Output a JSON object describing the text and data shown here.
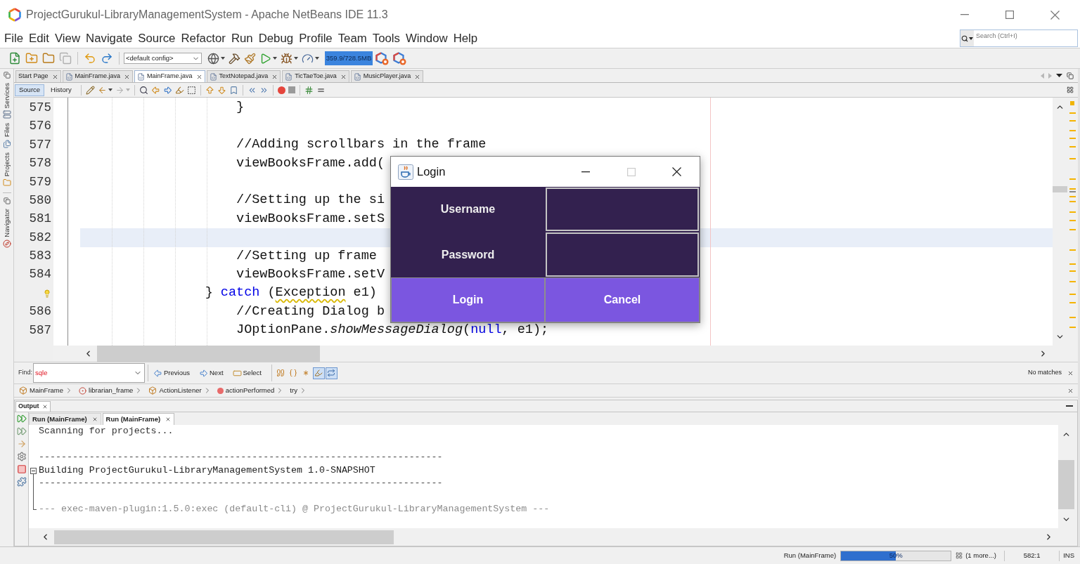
{
  "window": {
    "title": "ProjectGurukul-LibraryManagementSystem - Apache NetBeans IDE 11.3"
  },
  "menu": [
    "File",
    "Edit",
    "View",
    "Navigate",
    "Source",
    "Refactor",
    "Run",
    "Debug",
    "Profile",
    "Team",
    "Tools",
    "Window",
    "Help"
  ],
  "search": {
    "placeholder": "Search (Ctrl+I)"
  },
  "toolbar": {
    "file_buttons": [
      {
        "disabled": false
      },
      {
        "disabled": false
      },
      {
        "disabled": false
      },
      {
        "disabled": true
      }
    ],
    "config": "<default config>",
    "memory": "359.9/728.5MB"
  },
  "side_tabs": [
    "Services",
    "Files",
    "Projects",
    "Navigator"
  ],
  "editor": {
    "tabs": [
      {
        "kind": "page",
        "label": "Start Page",
        "selected": false
      },
      {
        "kind": "file",
        "label": "MainFrame.java",
        "selected": false
      },
      {
        "kind": "file",
        "label": "MainFrame.java",
        "selected": true
      },
      {
        "kind": "file",
        "label": "TextNotepad.java",
        "selected": false
      },
      {
        "kind": "file",
        "label": "TicTaeToe.java",
        "selected": false
      },
      {
        "kind": "file",
        "label": "MusicPlayer.java",
        "selected": false
      }
    ],
    "views": [
      {
        "label": "Source",
        "selected": true
      },
      {
        "label": "History",
        "selected": false
      }
    ],
    "nav_buttons": [
      {
        "disabled": false
      },
      {
        "disabled": false
      },
      {
        "disabled": true
      }
    ],
    "lines": [
      {
        "number": "575",
        "current": false,
        "hint": false,
        "tokens": [
          {
            "kind": "plain",
            "text": "                    }"
          }
        ]
      },
      {
        "number": "576",
        "current": false,
        "hint": false
      },
      {
        "number": "577",
        "current": false,
        "hint": false,
        "tokens": [
          {
            "kind": "plain",
            "text": "                    //Adding scrollbars in the frame"
          }
        ]
      },
      {
        "number": "578",
        "current": false,
        "hint": false,
        "tokens": [
          {
            "kind": "plain",
            "text": "                    viewBooksFrame.add("
          }
        ]
      },
      {
        "number": "579",
        "current": false,
        "hint": false
      },
      {
        "number": "580",
        "current": false,
        "hint": false,
        "tokens": [
          {
            "kind": "plain",
            "text": "                    //Setting up the si"
          }
        ]
      },
      {
        "number": "581",
        "current": false,
        "hint": false,
        "tokens": [
          {
            "kind": "plain",
            "text": "                    viewBooksFrame.setS"
          }
        ]
      },
      {
        "number": "582",
        "current": true,
        "hint": false
      },
      {
        "number": "583",
        "current": false,
        "hint": false,
        "tokens": [
          {
            "kind": "plain",
            "text": "                    //Setting up frame"
          }
        ]
      },
      {
        "number": "584",
        "current": false,
        "hint": false,
        "tokens": [
          {
            "kind": "plain",
            "text": "                    viewBooksFrame.setV"
          }
        ]
      },
      {
        "current": false,
        "hint": true,
        "tokens": [
          {
            "kind": "plain",
            "text": "                } "
          },
          {
            "kind": "keyword",
            "text": "catch"
          },
          {
            "kind": "plain",
            "text": " ("
          },
          {
            "kind": "warning",
            "text": "Exception"
          },
          {
            "kind": "plain",
            "text": " e1)"
          }
        ]
      },
      {
        "number": "586",
        "current": false,
        "hint": false,
        "tokens": [
          {
            "kind": "plain",
            "text": "                    //Creating Dialog b"
          }
        ]
      },
      {
        "number": "587",
        "current": false,
        "hint": false,
        "tokens": [
          {
            "kind": "plain",
            "text": "                    JOptionPane."
          },
          {
            "kind": "method",
            "text": "showMessageDialog"
          },
          {
            "kind": "plain",
            "text": "("
          },
          {
            "kind": "keyword",
            "text": "null"
          },
          {
            "kind": "plain",
            "text": ", e1);"
          }
        ]
      }
    ]
  },
  "login_dialog": {
    "title": "Login",
    "maximize_disabled": true,
    "fields": [
      {
        "label": "Username"
      },
      {
        "label": "Password"
      }
    ],
    "buttons": [
      "Login",
      "Cancel"
    ]
  },
  "find_bar": {
    "label": "Find:",
    "value": "sqle",
    "buttons": [
      "Previous",
      "Next",
      "Select"
    ],
    "toggles": [
      {
        "on": false
      },
      {
        "on": false
      },
      {
        "on": false
      },
      {
        "on": true
      },
      {
        "on": true
      }
    ],
    "status": "No matches"
  },
  "breadcrumbs": [
    {
      "kind": "class",
      "label": "MainFrame"
    },
    {
      "kind": "field",
      "label": "librarian_frame"
    },
    {
      "kind": "class",
      "label": "ActionListener"
    },
    {
      "kind": "method",
      "label": "actionPerformed"
    },
    {
      "kind": "block",
      "label": "try"
    }
  ],
  "output": {
    "title": "Output",
    "tabs": [
      {
        "label": "Run (MainFrame)",
        "selected": false
      },
      {
        "label": "Run (MainFrame)",
        "selected": true
      }
    ],
    "lines": [
      {
        "kind": "info",
        "text": "Scanning for projects..."
      },
      {
        "kind": "rule",
        "text": "------------------------------------------------------------------------"
      },
      {
        "kind": "heading",
        "text": "Building ProjectGurukul-LibraryManagementSystem 1.0-SNAPSHOT"
      },
      {
        "kind": "rule",
        "text": "------------------------------------------------------------------------"
      },
      {
        "kind": "plugin",
        "text": "--- exec-maven-plugin:1.5.0:exec (default-cli) @ ProjectGurukul-LibraryManagementSystem ---"
      }
    ]
  },
  "status_bar": {
    "task": "Run (MainFrame)",
    "progress": {
      "level": 0.5,
      "reading": "50%"
    },
    "more": "(1 more...)",
    "position": "582:1",
    "mode": "INS"
  }
}
